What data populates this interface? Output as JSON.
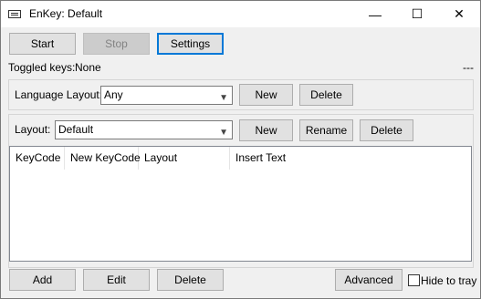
{
  "window": {
    "title": "EnKey: Default",
    "icon": "keyboard-icon",
    "controls": {
      "minimize": "—",
      "maximize": "☐",
      "close": "✕"
    }
  },
  "toolbar": {
    "start_label": "Start",
    "stop_label": "Stop",
    "settings_label": "Settings"
  },
  "status": {
    "toggled_label": "Toggled keys:",
    "toggled_value": "None",
    "right_text": "---"
  },
  "language_layout": {
    "label": "Language Layout:",
    "selected": "Any",
    "new_label": "New",
    "delete_label": "Delete"
  },
  "layout": {
    "label": "Layout:",
    "selected": "Default",
    "new_label": "New",
    "rename_label": "Rename",
    "delete_label": "Delete"
  },
  "table": {
    "columns": [
      "KeyCode",
      "New KeyCode",
      "Layout",
      "Insert Text"
    ],
    "rows": []
  },
  "footer": {
    "add_label": "Add",
    "edit_label": "Edit",
    "delete_label": "Delete",
    "advanced_label": "Advanced",
    "hide_to_tray_label": "Hide to tray",
    "hide_to_tray_checked": false
  }
}
